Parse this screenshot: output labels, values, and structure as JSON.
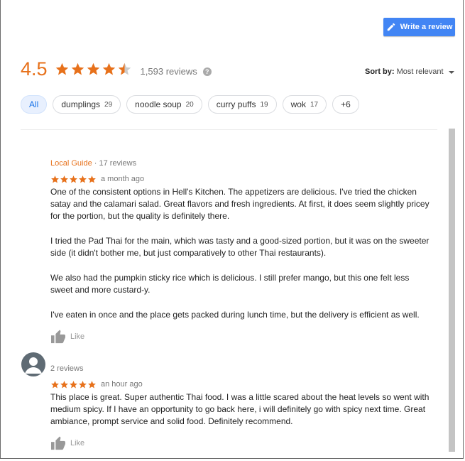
{
  "header": {
    "write_review_label": "Write a review",
    "rating_value": "4.5",
    "rating_stars": 4.5,
    "review_count": "1,593 reviews",
    "help_glyph": "?",
    "sort_label": "Sort by:",
    "sort_value": "Most relevant"
  },
  "filters": [
    {
      "label": "All",
      "count": ""
    },
    {
      "label": "dumplings",
      "count": "29"
    },
    {
      "label": "noodle soup",
      "count": "20"
    },
    {
      "label": "curry puffs",
      "count": "19"
    },
    {
      "label": "wok",
      "count": "17"
    },
    {
      "label": "+6",
      "count": ""
    }
  ],
  "reviews": [
    {
      "guide_label": "Local Guide",
      "meta": " · 17 reviews",
      "stars": 5,
      "time": "a month ago",
      "paragraphs": [
        "One of the consistent options in Hell's Kitchen. The appetizers are delicious. I've tried the chicken satay and the calamari salad. Great flavors and fresh ingredients. At first, it does seem slightly pricey for the portion, but the quality is definitely there.",
        "I tried the Pad Thai for the main, which was tasty and a good-sized portion, but it was on the sweeter side (it didn't bother me, but just comparatively to other Thai restaurants).",
        "We also had the pumpkin sticky rice which is delicious. I still prefer mango, but this one felt less sweet and more custard-y.",
        "I've eaten in once and the place gets packed during lunch time, but the delivery is efficient as well."
      ],
      "like_label": "Like"
    },
    {
      "meta": "2 reviews",
      "stars": 5,
      "time": "an hour ago",
      "paragraphs": [
        "This place is great. Super authentic Thai food. I was a little scared about the heat levels so went with medium spicy. If I have an opportunity to go back here, i will definitely go with spicy next time. Great ambiance, prompt service and solid food. Definitely recommend."
      ],
      "like_label": "Like"
    }
  ],
  "colors": {
    "accent_orange": "#e7711b",
    "star_orange": "#e7711b",
    "button_blue": "#4285f4",
    "chip_active_bg": "#e8f0fe",
    "chip_active_text": "#1a73e8"
  },
  "icons": {
    "write_button": "pencil-icon",
    "help": "help-icon",
    "sort": "caret-down-icon",
    "star": "star-icon",
    "like": "thumbs-up-icon",
    "avatar": "default-avatar-icon"
  }
}
